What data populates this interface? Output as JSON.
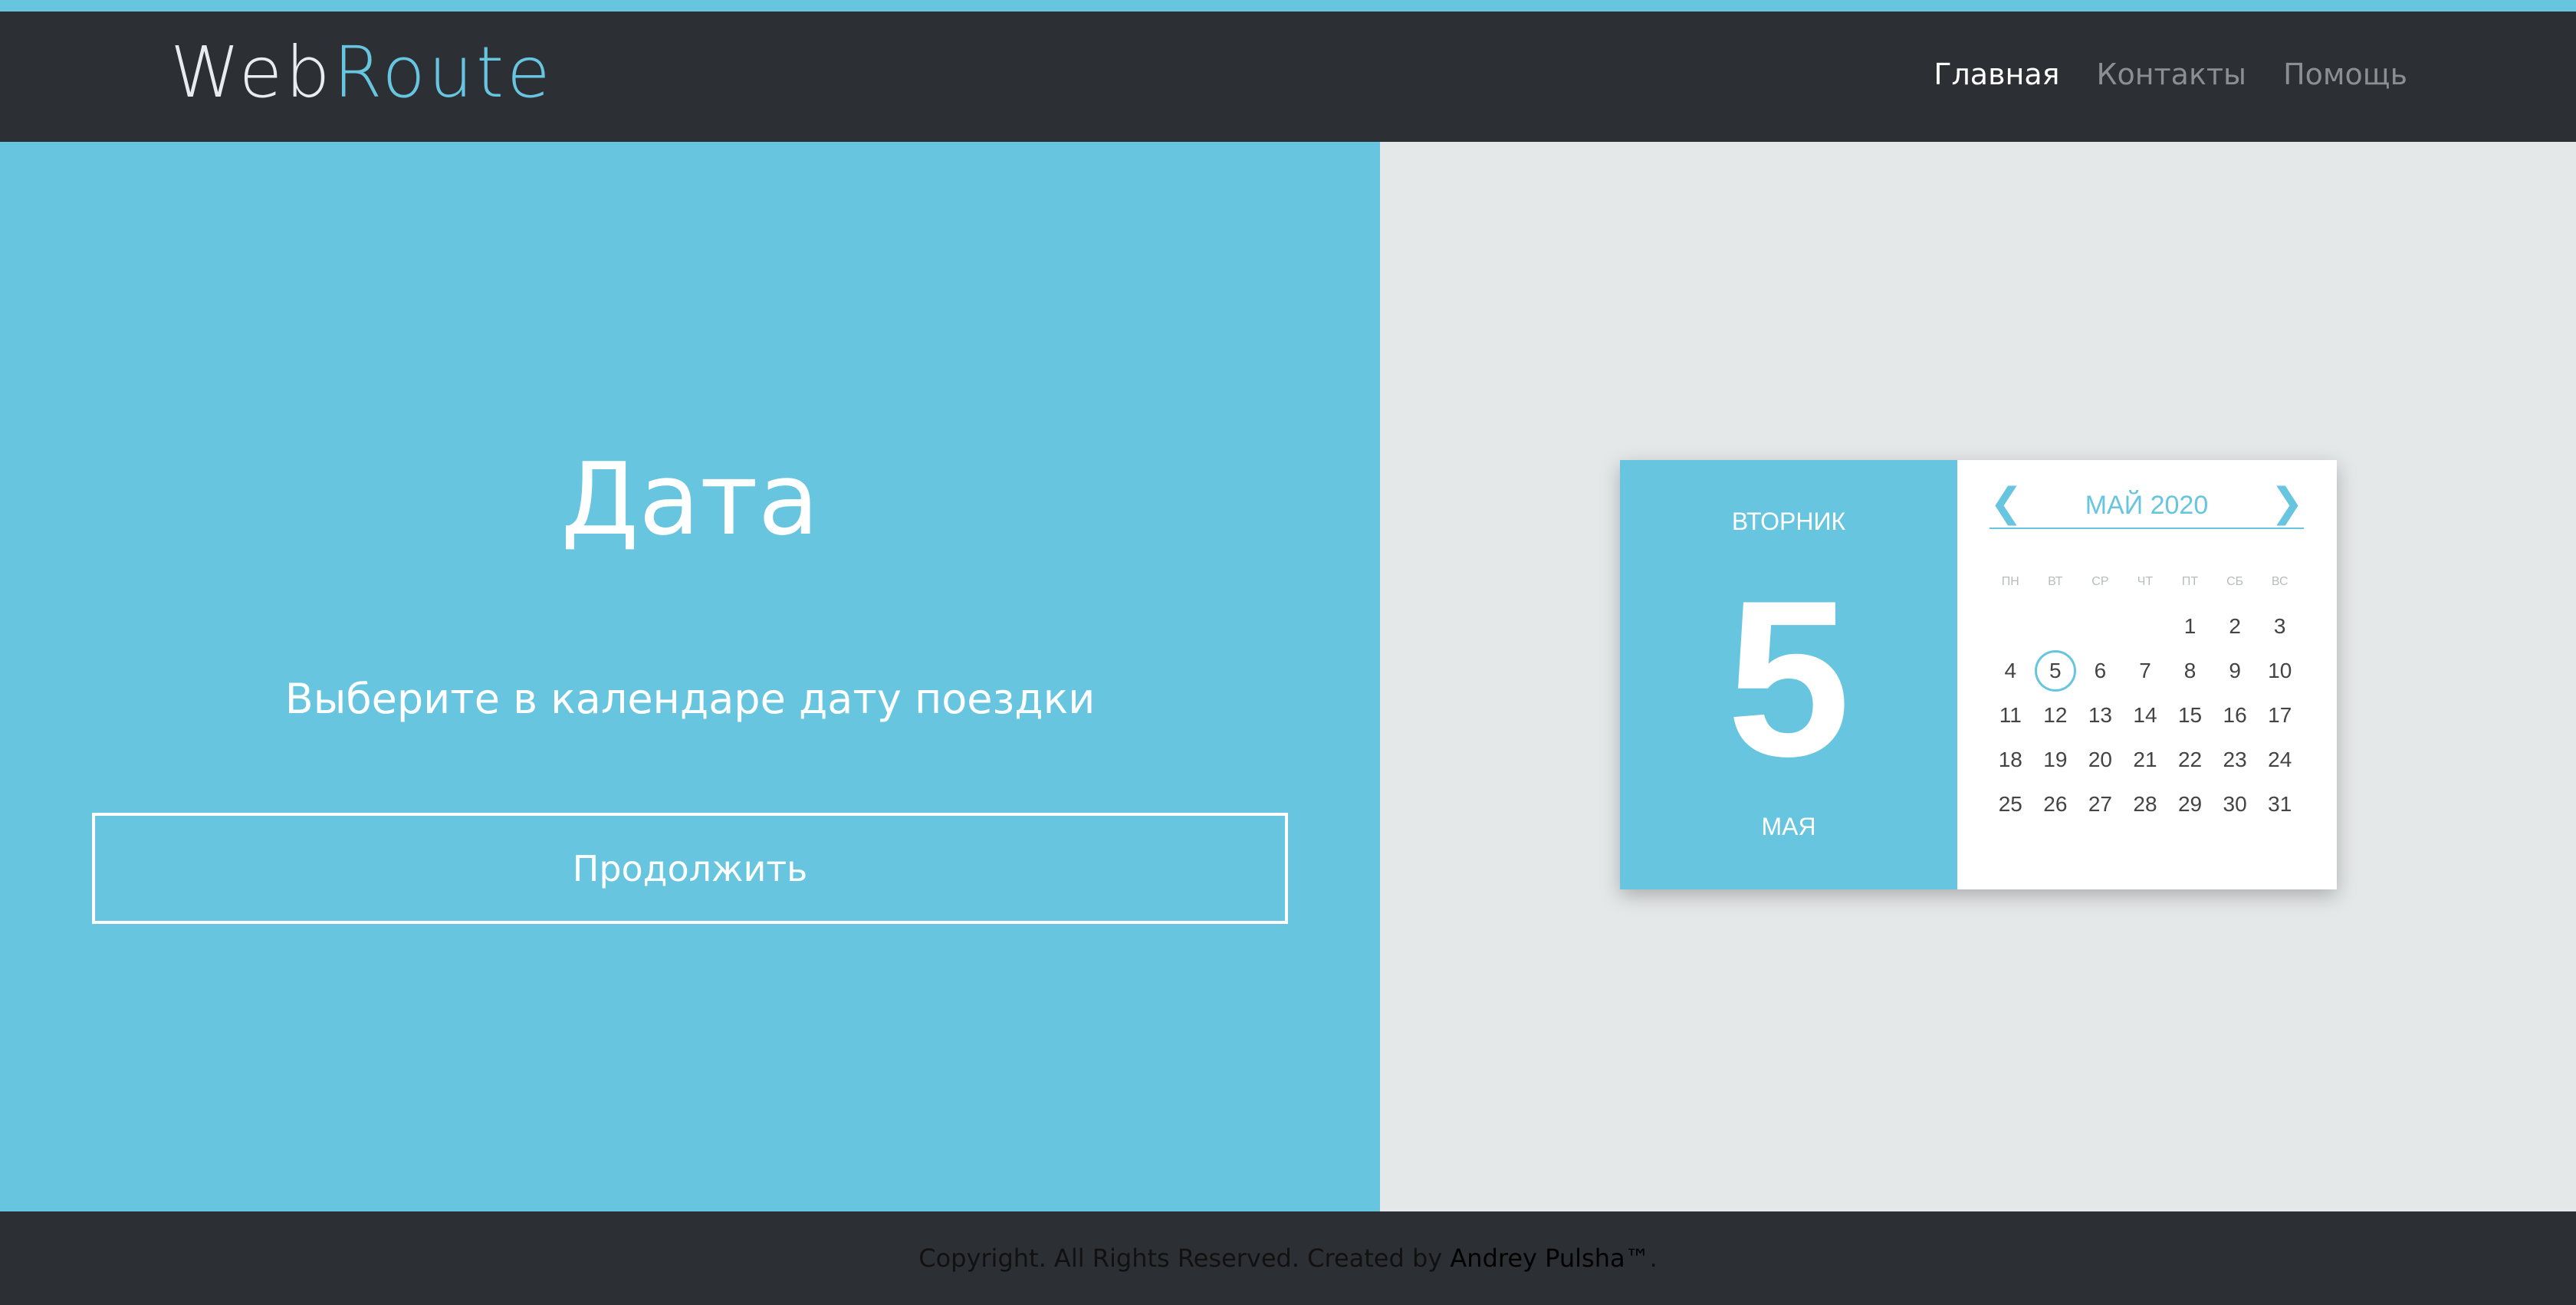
{
  "header": {
    "logo_part_a": "Web",
    "logo_part_b": "Route",
    "nav": [
      "Главная",
      "Контакты",
      "Помощь"
    ]
  },
  "hero": {
    "title": "Дата",
    "subtitle": "Выберите в календаре дату поездки",
    "button": "Продолжить"
  },
  "calendar": {
    "weekday": "ВТОРНИК",
    "day": "5",
    "month_genitive": "МАЯ",
    "month_label": "МАЙ 2020",
    "prev_icon": "❮",
    "next_icon": "❯",
    "days_of_week": [
      "ПН",
      "ВТ",
      "СР",
      "ЧТ",
      "ПТ",
      "СБ",
      "ВС"
    ],
    "days": [
      "",
      "",
      "",
      "",
      "1",
      "2",
      "3",
      "4",
      "5",
      "6",
      "7",
      "8",
      "9",
      "10",
      "11",
      "12",
      "13",
      "14",
      "15",
      "16",
      "17",
      "18",
      "19",
      "20",
      "21",
      "22",
      "23",
      "24",
      "25",
      "26",
      "27",
      "28",
      "29",
      "30",
      "31"
    ]
  },
  "footer": {
    "text": "Copyright. All Rights Reserved. Created by ",
    "author": "Andrey Pulsha™",
    "dot": "."
  },
  "colors": {
    "accent": "#67c5df",
    "dark": "#2c2f33",
    "light_panel": "#e5e8e9"
  }
}
